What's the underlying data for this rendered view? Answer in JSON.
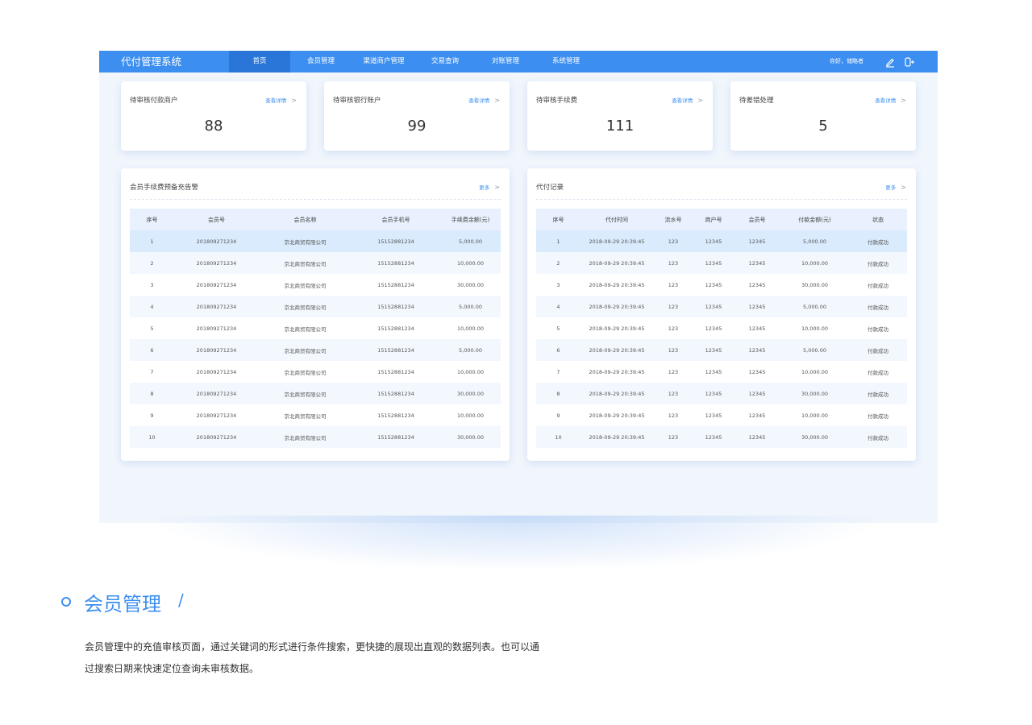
{
  "app": {
    "title": "代付管理系统",
    "nav": [
      "首页",
      "会员管理",
      "渠道商户管理",
      "交易查询",
      "对账管理",
      "系统管理"
    ],
    "active_nav": "首页",
    "greeting": "你好，储略者",
    "accent_color": "#3c8ff0",
    "icons": [
      "edit-icon",
      "logout-icon"
    ]
  },
  "stats": [
    {
      "title": "待审核付款商户",
      "link": "查看详情",
      "value": "88"
    },
    {
      "title": "待审核银行账户",
      "link": "查看详情",
      "value": "99"
    },
    {
      "title": "待审核手续费",
      "link": "查看详情",
      "value": "111"
    },
    {
      "title": "待差错处理",
      "link": "查看详情",
      "value": "5"
    }
  ],
  "fee_panel": {
    "title": "会员手续费预备充告警",
    "more": "更多",
    "columns": [
      "序号",
      "会员号",
      "会员名称",
      "会员手机号",
      "手续费余额(元)"
    ],
    "rows": [
      [
        "1",
        "201809271234",
        "京北商贸有限公司",
        "15152881234",
        "5,000.00"
      ],
      [
        "2",
        "201809271234",
        "京北商贸有限公司",
        "15152881234",
        "10,000.00"
      ],
      [
        "3",
        "201809271234",
        "京北商贸有限公司",
        "15152881234",
        "30,000.00"
      ],
      [
        "4",
        "201809271234",
        "京北商贸有限公司",
        "15152881234",
        "5,000.00"
      ],
      [
        "5",
        "201809271234",
        "京北商贸有限公司",
        "15152881234",
        "10,000.00"
      ],
      [
        "6",
        "201809271234",
        "京北商贸有限公司",
        "15152881234",
        "5,000.00"
      ],
      [
        "7",
        "201809271234",
        "京北商贸有限公司",
        "15152881234",
        "10,000.00"
      ],
      [
        "8",
        "201809271234",
        "京北商贸有限公司",
        "15152881234",
        "30,000.00"
      ],
      [
        "9",
        "201809271234",
        "京北商贸有限公司",
        "15152881234",
        "10,000.00"
      ],
      [
        "10",
        "201809271234",
        "京北商贸有限公司",
        "15152881234",
        "30,000.00"
      ]
    ]
  },
  "payment_panel": {
    "title": "代付记录",
    "more": "更多",
    "columns": [
      "序号",
      "代付时间",
      "流水号",
      "商户号",
      "会员号",
      "付款金额(元)",
      "状态"
    ],
    "rows": [
      [
        "1",
        "2018-09-29 20:39:45",
        "123",
        "12345",
        "12345",
        "5,000.00",
        "付款成功"
      ],
      [
        "2",
        "2018-09-29 20:39:45",
        "123",
        "12345",
        "12345",
        "10,000.00",
        "付款成功"
      ],
      [
        "3",
        "2018-09-29 20:39:45",
        "123",
        "12345",
        "12345",
        "30,000.00",
        "付款成功"
      ],
      [
        "4",
        "2018-09-29 20:39:45",
        "123",
        "12345",
        "12345",
        "5,000.00",
        "付款成功"
      ],
      [
        "5",
        "2018-09-29 20:39:45",
        "123",
        "12345",
        "12345",
        "10,000.00",
        "付款成功"
      ],
      [
        "6",
        "2018-09-29 20:39:45",
        "123",
        "12345",
        "12345",
        "5,000.00",
        "付款成功"
      ],
      [
        "7",
        "2018-09-29 20:39:45",
        "123",
        "12345",
        "12345",
        "10,000.00",
        "付款成功"
      ],
      [
        "8",
        "2018-09-29 20:39:45",
        "123",
        "12345",
        "12345",
        "30,000.00",
        "付款成功"
      ],
      [
        "9",
        "2018-09-29 20:39:45",
        "123",
        "12345",
        "12345",
        "10,000.00",
        "付款成功"
      ],
      [
        "10",
        "2018-09-29 20:39:45",
        "123",
        "12345",
        "12345",
        "30,000.00",
        "付款成功"
      ]
    ]
  },
  "section": {
    "title": "会员管理",
    "slash": "/",
    "description_lines": [
      "会员管理中的充值审核页面，通过关键词的形式进行条件搜索，更快捷的展现出直观的数据列表。也可以通",
      "过搜索日期来快速定位查询未审核数据。"
    ]
  }
}
